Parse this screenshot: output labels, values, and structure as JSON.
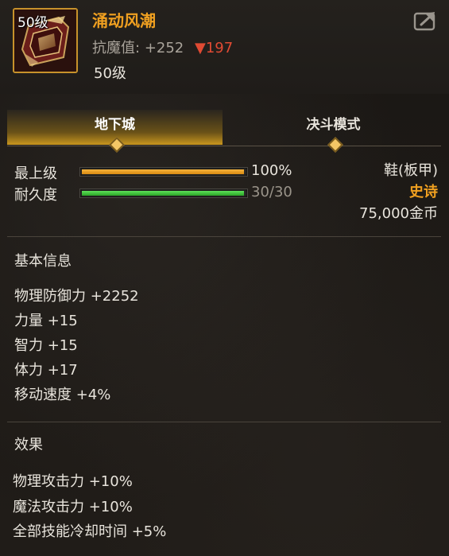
{
  "item": {
    "level_badge": "50级",
    "name": "涌动风潮",
    "resist_label": "抗魔值:",
    "resist_value": "+252",
    "resist_down": "▼197",
    "level_text": "50级"
  },
  "tabs": [
    {
      "label": "地下城",
      "active": true
    },
    {
      "label": "决斗模式",
      "active": false
    }
  ],
  "bars": {
    "max_level": {
      "label": "最上级",
      "value_text": "100%",
      "fill": 1.0
    },
    "durability": {
      "label": "耐久度",
      "value_text": "30/30",
      "fill": 1.0
    }
  },
  "right_info": {
    "type": "鞋(板甲)",
    "rarity": "史诗",
    "price": "75,000金币"
  },
  "basic_info": {
    "title": "基本信息",
    "stats": [
      "物理防御力 +2252",
      "力量 +15",
      "智力 +15",
      "体力 +17",
      "移动速度 +4%"
    ]
  },
  "effects": {
    "title": "效果",
    "stats": [
      "物理攻击力 +10%",
      "魔法攻击力 +10%",
      "全部技能冷却时间 +5%"
    ]
  },
  "colors": {
    "accent_gold": "#f0a020",
    "down_red": "#e04a33",
    "bar_orange": "#e09a1e",
    "bar_green": "#3cc838"
  },
  "icons": {
    "share": "share-icon",
    "item": "boot-armor-icon"
  }
}
